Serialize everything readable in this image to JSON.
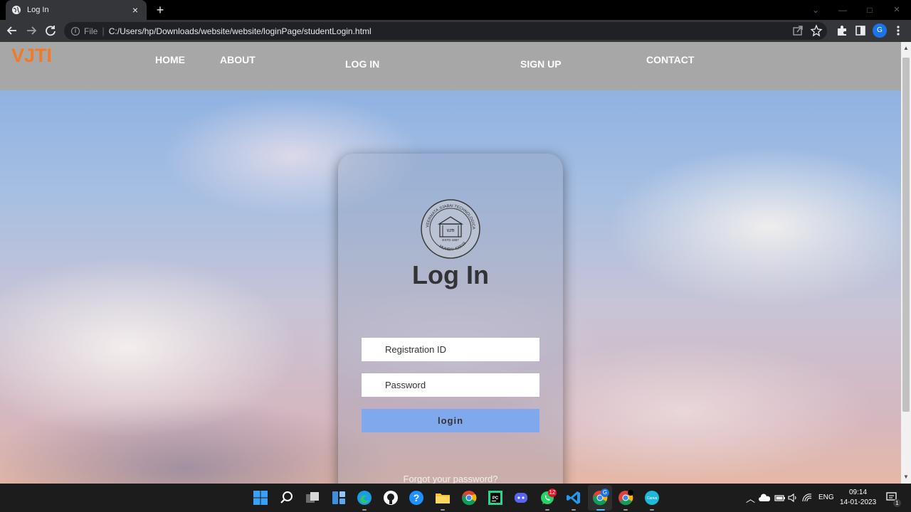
{
  "browser": {
    "tab": {
      "title": "Log In",
      "close": "×"
    },
    "new_tab": "+",
    "window_controls": {
      "dropdown": "⌄",
      "minimize": "—",
      "maximize": "□",
      "close": "×"
    },
    "address": {
      "scheme": "File",
      "separator": "|",
      "url": "C:/Users/hp/Downloads/website/website/loginPage/studentLogin.html"
    },
    "profile_initial": "G"
  },
  "navbar": {
    "brand": "VJTI",
    "brand_color": "#f37a23",
    "links": [
      "HOME",
      "ABOUT",
      "LOG IN",
      "SIGN UP",
      "CONTACT"
    ]
  },
  "login_card": {
    "emblem_top_text": "VEERMATA JIJABAI TECHNOLOGICAL INSTITUTE",
    "emblem_center": "VJTI",
    "emblem_estd": "ESTD 1887",
    "emblem_bottom": "MUMBAI 400019",
    "title": "Log In",
    "registration_placeholder": "Registration ID",
    "password_placeholder": "Password",
    "login_label": "login",
    "forgot_label": "Forgot your password?",
    "button_color": "#80a9ed"
  },
  "taskbar": {
    "apps": [
      "start-icon",
      "search-icon",
      "task-view-icon",
      "widgets-icon",
      "edge-icon",
      "github-icon",
      "help-icon",
      "file-explorer-icon",
      "chrome-icon",
      "pycharm-icon",
      "discord-icon",
      "whatsapp-icon",
      "vscode-icon",
      "chrome-profile-icon",
      "chrome-canary-icon",
      "canva-icon"
    ],
    "pycharm_label": "PC",
    "canva_label": "Canva",
    "whatsapp_badge": "12",
    "chrome_profile_badge": "G",
    "language": "ENG",
    "time": "09:14",
    "date": "14-01-2023",
    "notification_count": "1"
  }
}
